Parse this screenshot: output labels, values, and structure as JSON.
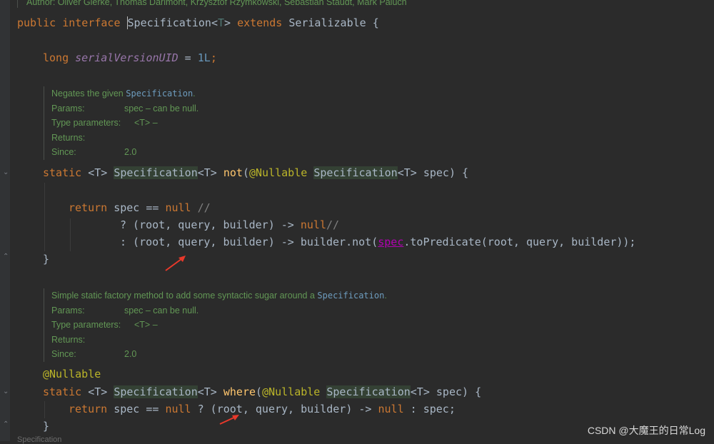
{
  "author_line": "Author: Oliver Gierke, Thomas Darimont, Krzysztof Rzymkowski, Sebastian Staudt, Mark Paluch",
  "code": {
    "line_interface": {
      "kw1": "public",
      "kw2": "interface",
      "name": "Specification",
      "lt": "<",
      "t": "T",
      "gt": ">",
      "kw3": "extends",
      "parent": "Serializable",
      "brace": "{"
    },
    "line_serial": {
      "type": "long",
      "field": "serialVersionUID",
      "eq": " = ",
      "val": "1L",
      "semi": ";"
    },
    "line_not_sig": {
      "kw": "static",
      "generic": "<T>",
      "ret": "Specification",
      "retg": "<T>",
      "name": "not",
      "open": "(",
      "ann": "@Nullable",
      "ptype": "Specification",
      "pgen": "<T>",
      "pname": " spec) {"
    },
    "line_return1": {
      "kw": "return",
      "mid": " spec == ",
      "null": "null",
      "cmt": " //"
    },
    "line_tern1": {
      "text": "? (root, query, builder) -> ",
      "null": "null",
      "cmt": "//"
    },
    "line_tern2": {
      "pre": ": (root, query, builder) -> builder.not(",
      "spec": "spec",
      "post": ".toPredicate(root, query, builder));"
    },
    "close1": "}",
    "ann_nullable": "@Nullable",
    "line_where_sig": {
      "kw": "static",
      "generic": "<T>",
      "ret": "Specification",
      "retg": "<T>",
      "name": "where",
      "open": "(",
      "ann": "@Nullable",
      "ptype": "Specification",
      "pgen": "<T>",
      "pname": " spec) {"
    },
    "line_return2": {
      "kw": "return",
      "mid": " spec == ",
      "null": "null",
      "rest": " ? (root, query, builder) -> ",
      "null2": "null",
      "tail": " : spec;"
    },
    "close2": "}"
  },
  "doc1": {
    "summary_pre": "Negates the given ",
    "summary_ref": "Specification",
    "summary_post": ".",
    "params_label": "Params:",
    "params_val": "spec – can be null.",
    "type_label": "Type parameters:",
    "type_val": "<T> –",
    "returns_label": "Returns:",
    "since_label": "Since:",
    "since_val": "2.0"
  },
  "doc2": {
    "summary_pre": "Simple static factory method to add some syntactic sugar around a ",
    "summary_ref": "Specification",
    "summary_post": ".",
    "params_label": "Params:",
    "params_val": "spec – can be null.",
    "type_label": "Type parameters:",
    "type_val": "<T> –",
    "returns_label": "Returns:",
    "since_label": "Since:",
    "since_val": "2.0"
  },
  "watermark": "CSDN @大魔王的日常Log",
  "bottom_stub": "Specification",
  "colors": {
    "background": "#2b2b2b",
    "keyword": "#cc7832",
    "doc": "#629755",
    "arrow": "#e8392b"
  }
}
